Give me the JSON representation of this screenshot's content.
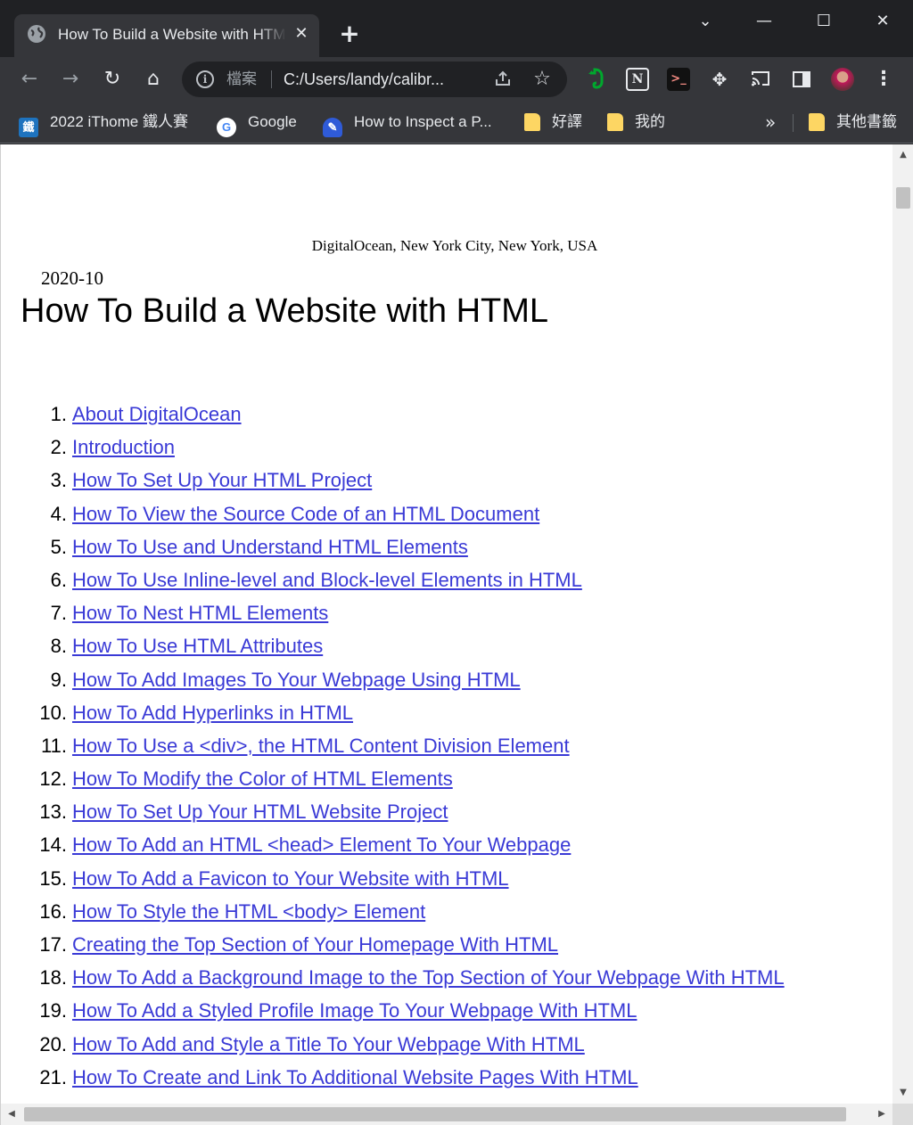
{
  "browser": {
    "tab_title": "How To Build a Website with HTML",
    "tab_close_glyph": "✕",
    "new_tab_glyph": "+",
    "window_controls": {
      "dropdown": "⌄",
      "minimize": "—",
      "maximize": "☐",
      "close": "✕"
    },
    "nav": {
      "back": "←",
      "forward": "→",
      "reload": "↻",
      "home": "⌂"
    },
    "omnibox": {
      "scheme_label": "檔案",
      "url": "C:/Users/landy/calibr...",
      "share_icon": "share-icon",
      "star": "☆"
    },
    "extensions": [
      {
        "name": "evernote-icon"
      },
      {
        "name": "notion-icon",
        "glyph": "N"
      },
      {
        "name": "terminal-icon",
        "glyph": ">_"
      },
      {
        "name": "puzzle-icon",
        "glyph": "✥"
      },
      {
        "name": "cast-icon",
        "glyph": "⎚"
      },
      {
        "name": "side-panel-icon"
      },
      {
        "name": "profile-avatar"
      },
      {
        "name": "kebab-menu-icon",
        "glyph": "⋮"
      }
    ],
    "bookmarks": [
      {
        "label": "2022 iThome 鐵人賽",
        "icon": "ithome-icon"
      },
      {
        "label": "Google",
        "icon": "google-icon"
      },
      {
        "label": "How to Inspect a P...",
        "icon": "inspect-icon"
      },
      {
        "label": "好譯",
        "icon": "folder-icon"
      },
      {
        "label": "我的",
        "icon": "folder-icon"
      }
    ],
    "bookmarks_more": "»",
    "other_bookmarks": "其他書籤"
  },
  "page": {
    "publisher": "DigitalOcean, New York City, New York, USA",
    "date": "2020-10",
    "title": "How To Build a Website with HTML",
    "toc": [
      {
        "num": "1.",
        "label": "About DigitalOcean"
      },
      {
        "num": "2.",
        "label": "Introduction"
      },
      {
        "num": "3.",
        "label": "How To Set Up Your HTML Project"
      },
      {
        "num": "4.",
        "label": "How To View the Source Code of an HTML Document"
      },
      {
        "num": "5.",
        "label": "How To Use and Understand HTML Elements"
      },
      {
        "num": "6.",
        "label": "How To Use Inline-level and Block-level Elements in HTML"
      },
      {
        "num": "7.",
        "label": "How To Nest HTML Elements"
      },
      {
        "num": "8.",
        "label": "How To Use HTML Attributes"
      },
      {
        "num": "9.",
        "label": "How To Add Images To Your Webpage Using HTML"
      },
      {
        "num": "10.",
        "label": "How To Add Hyperlinks in HTML"
      },
      {
        "num": "11.",
        "label": "How To Use a <div>, the HTML Content Division Element"
      },
      {
        "num": "12.",
        "label": "How To Modify the Color of HTML Elements"
      },
      {
        "num": "13.",
        "label": "How To Set Up Your HTML Website Project"
      },
      {
        "num": "14.",
        "label": "How To Add an HTML <head> Element To Your Webpage"
      },
      {
        "num": "15.",
        "label": "How To Add a Favicon to Your Website with HTML"
      },
      {
        "num": "16.",
        "label": "How To Style the HTML <body> Element"
      },
      {
        "num": "17.",
        "label": "Creating the Top Section of Your Homepage With HTML"
      },
      {
        "num": "18.",
        "label": "How To Add a Background Image to the Top Section of Your Webpage With HTML"
      },
      {
        "num": "19.",
        "label": "How To Add a Styled Profile Image To Your Webpage With HTML"
      },
      {
        "num": "20.",
        "label": "How To Add and Style a Title To Your Webpage With HTML"
      },
      {
        "num": "21.",
        "label": "How To Create and Link To Additional Website Pages With HTML"
      }
    ],
    "link_color": "#3a3ad6"
  },
  "scrollbars": {
    "up": "▲",
    "down": "▼",
    "left": "◀",
    "right": "▶"
  }
}
